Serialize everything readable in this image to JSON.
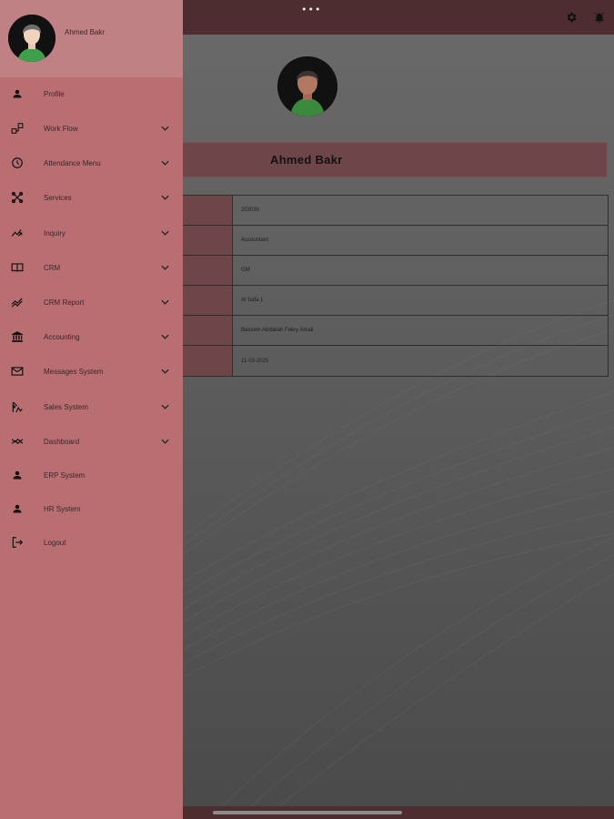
{
  "topbar": {
    "dots": "•••"
  },
  "profile": {
    "name": "Ahmed Bakr",
    "rows": [
      {
        "value": "203030"
      },
      {
        "value": "Accountant"
      },
      {
        "value": "GM"
      },
      {
        "value": "Al Safa 1"
      },
      {
        "value": "Bassem Abdallah Fekry Amali"
      },
      {
        "value": "11-03-2025"
      }
    ]
  },
  "drawer": {
    "username": "Ahmed Bakr",
    "items": [
      {
        "label": "Profile",
        "icon": "person-icon",
        "expandable": false
      },
      {
        "label": "Work Flow",
        "icon": "workflow-icon",
        "expandable": true
      },
      {
        "label": "Attendance Menu",
        "icon": "clock-icon",
        "expandable": true
      },
      {
        "label": "Services",
        "icon": "services-icon",
        "expandable": true
      },
      {
        "label": "Inquiry",
        "icon": "inquiry-icon",
        "expandable": true
      },
      {
        "label": "CRM",
        "icon": "book-icon",
        "expandable": true
      },
      {
        "label": "CRM Report",
        "icon": "trend-icon",
        "expandable": true
      },
      {
        "label": "Accounting",
        "icon": "bank-icon",
        "expandable": true
      },
      {
        "label": "Messages System",
        "icon": "mail-icon",
        "expandable": true
      },
      {
        "label": "Sales System",
        "icon": "sales-icon",
        "expandable": true
      },
      {
        "label": "Dashboard",
        "icon": "dashboard-icon",
        "expandable": true
      },
      {
        "label": "ERP System",
        "icon": "person-icon",
        "expandable": false
      },
      {
        "label": "HR System",
        "icon": "person-icon",
        "expandable": false
      },
      {
        "label": "Logout",
        "icon": "logout-icon",
        "expandable": false
      }
    ]
  },
  "colors": {
    "drawer_bg": "#b96e72",
    "drawer_header": "#c08185",
    "topbar": "#4e2d31",
    "label_cell": "#6e4549"
  }
}
